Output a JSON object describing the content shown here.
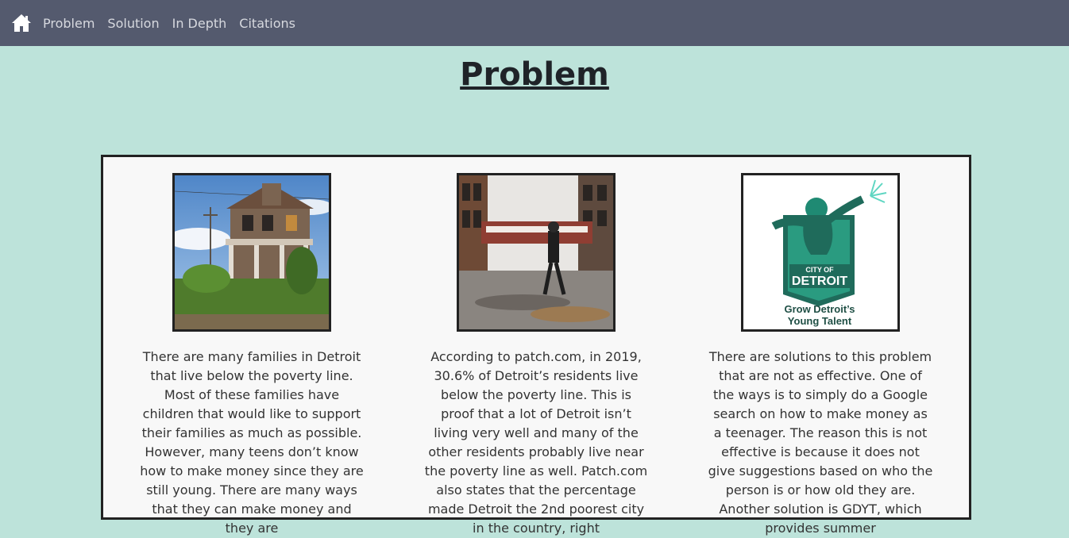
{
  "nav": {
    "items": [
      {
        "label": "Problem"
      },
      {
        "label": "Solution"
      },
      {
        "label": "In Depth"
      },
      {
        "label": "Citations"
      }
    ]
  },
  "page": {
    "title": "Problem"
  },
  "columns": [
    {
      "image": "abandoned-house-photo",
      "text": "There are many families in Detroit that live below the poverty line. Most of these families have children that would like to support their families as much as possible. However, many teens don’t know how to make money since they are still young. There are many ways that they can make money and they are"
    },
    {
      "image": "abandoned-factory-photo",
      "text": "According to patch.com, in 2019, 30.6% of Detroit’s residents live below the poverty line. This is proof that a lot of Detroit isn’t living very well and many of the other residents probably live near the poverty line as well. Patch.com also states that the percentage made Detroit the 2nd poorest city in the country, right"
    },
    {
      "image": "gdyt-logo",
      "logo": {
        "line1": "CITY OF",
        "line2": "DETROIT",
        "line3": "Grow Detroit’s",
        "line4": "Young Talent"
      },
      "text": "There are solutions to this problem that are not as effective. One of the ways is to simply do a Google search on how to make money as a teenager. The reason this is not effective is because it does not give suggestions based on who the person is or how old they are. Another solution is GDYT, which provides summer"
    }
  ],
  "colors": {
    "navbar": "#545a6e",
    "background": "#bde3da",
    "card": "#f8f8f8",
    "logo_green": "#1f8a73"
  }
}
